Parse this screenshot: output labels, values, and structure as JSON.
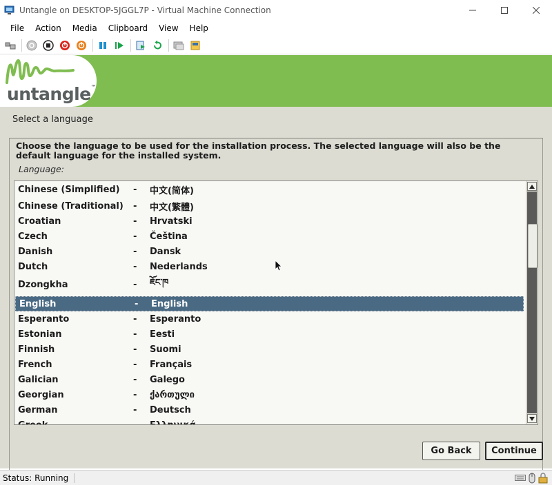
{
  "window": {
    "title": "Untangle on DESKTOP-5JGGL7P - Virtual Machine Connection",
    "controls": [
      "—",
      "☐",
      "✕"
    ]
  },
  "menu": [
    "File",
    "Action",
    "Media",
    "Clipboard",
    "View",
    "Help"
  ],
  "toolbar_icons": [
    "ctrl-alt-del-icon",
    "start-icon",
    "turn-off-icon",
    "shutdown-icon",
    "power-icon",
    "pause-icon",
    "resume-icon",
    "checkpoint-icon",
    "revert-icon",
    "enhanced-session-icon",
    "share-icon"
  ],
  "installer": {
    "brand": "untangle",
    "brand_tm": "™",
    "heading": "Select a language",
    "prompt": "Choose the language to be used for the installation process. The selected language will also be the default language for the installed system.",
    "list_label": "Language:",
    "languages": [
      {
        "name": "Chinese (Simplified)",
        "dash": "-",
        "native": "中文(简体)"
      },
      {
        "name": "Chinese (Traditional)",
        "dash": "-",
        "native": "中文(繁體)"
      },
      {
        "name": "Croatian",
        "dash": "-",
        "native": "Hrvatski"
      },
      {
        "name": "Czech",
        "dash": "-",
        "native": "Čeština"
      },
      {
        "name": "Danish",
        "dash": "-",
        "native": "Dansk"
      },
      {
        "name": "Dutch",
        "dash": "-",
        "native": "Nederlands"
      },
      {
        "name": "Dzongkha",
        "dash": "-",
        "native": "ཇོང་ཁ"
      },
      {
        "name": "English",
        "dash": "-",
        "native": "English"
      },
      {
        "name": "Esperanto",
        "dash": "-",
        "native": "Esperanto"
      },
      {
        "name": "Estonian",
        "dash": "-",
        "native": "Eesti"
      },
      {
        "name": "Finnish",
        "dash": "-",
        "native": "Suomi"
      },
      {
        "name": "French",
        "dash": "-",
        "native": "Français"
      },
      {
        "name": "Galician",
        "dash": "-",
        "native": "Galego"
      },
      {
        "name": "Georgian",
        "dash": "-",
        "native": "ქართული"
      },
      {
        "name": "German",
        "dash": "-",
        "native": "Deutsch"
      },
      {
        "name": "Greek",
        "dash": "-",
        "native": "Ελληνικά"
      }
    ],
    "selected_language": "English",
    "buttons": {
      "back": "Go Back",
      "continue": "Continue"
    }
  },
  "status": {
    "text": "Status: Running"
  },
  "colors": {
    "banner": "#80bd51",
    "selection": "#4a6a84",
    "background": "#dcdcd3"
  }
}
